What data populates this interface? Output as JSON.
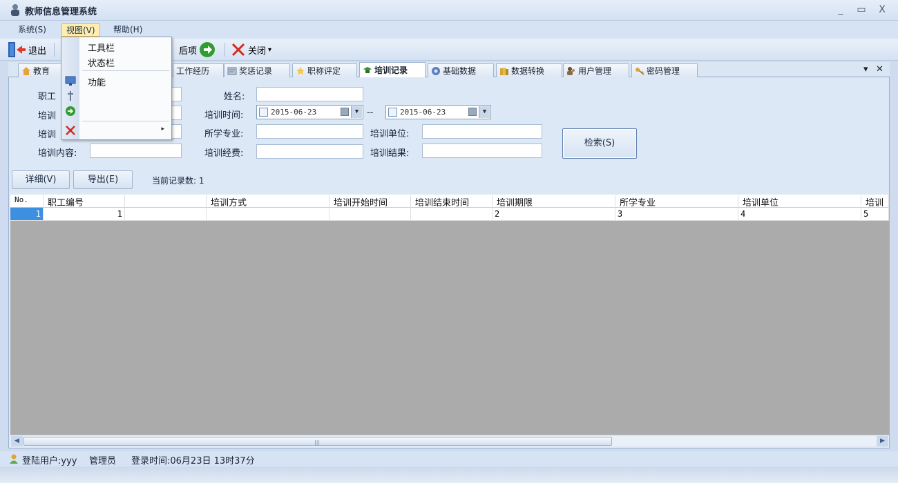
{
  "window": {
    "title": "教师信息管理系统",
    "min": "_",
    "max": "▭",
    "close": "X"
  },
  "menu": [
    {
      "label": "系统(S)"
    },
    {
      "label": "视图(V)"
    },
    {
      "label": "帮助(H)"
    }
  ],
  "toolbar": {
    "exit": "退出",
    "next": "后项",
    "close": "关闭",
    "close_arrow": "▾"
  },
  "tabs": [
    {
      "label": "教育",
      "icon": "house-icon",
      "color": "#e7a33b"
    },
    {
      "label": "工作经历",
      "icon": "",
      "color": ""
    },
    {
      "label": "奖惩记录",
      "icon": "certificate-icon",
      "color": "#8a99b4"
    },
    {
      "label": "职称评定",
      "icon": "star-icon",
      "color": "#f4c84a"
    },
    {
      "label": "培训记录",
      "icon": "grad-cap-icon",
      "color": "#3c8d3a"
    },
    {
      "label": "基础数据",
      "icon": "gear-icon",
      "color": "#5a7ec4"
    },
    {
      "label": "数据转换",
      "icon": "books-icon",
      "color": "#d6a334"
    },
    {
      "label": "用户管理",
      "icon": "users-icon",
      "color": "#6b4b2c"
    },
    {
      "label": "密码管理",
      "icon": "key-icon",
      "color": "#d9a740"
    }
  ],
  "tab_ctrl": {
    "dropdown": "▾",
    "close": "✕"
  },
  "form": {
    "staff_id": "职工",
    "train_mode": "培训",
    "train_period": "培训",
    "train_content": "培训内容:",
    "name": "姓名:",
    "train_time": "培训时间:",
    "date_from": "2015-06-23",
    "date_sep": "--",
    "date_to": "2015-06-23",
    "major": "所学专业:",
    "train_fee": "培训经费:",
    "train_unit": "培训单位:",
    "train_result": "培训结果:",
    "search": "检索(S)"
  },
  "actions": {
    "detail": "详细(V)",
    "export": "导出(E)",
    "record_count": "当前记录数: 1"
  },
  "table": {
    "columns": [
      "No.",
      "职工编号",
      "",
      "培训方式",
      "培训开始时间",
      "培训结束时间",
      "培训期限",
      "所学专业",
      "培训单位",
      "培训"
    ],
    "rows": [
      [
        "1",
        "1",
        "",
        "",
        "",
        "",
        "2",
        "3",
        "4",
        "5"
      ]
    ]
  },
  "scroll": {
    "left": "◀",
    "right": "▶",
    "grip": "|||"
  },
  "status": {
    "user": "登陆用户:yyy",
    "role": "管理员",
    "login_time": "登录时间:06月23日 13时37分"
  },
  "view_menu": [
    {
      "label": "工具栏",
      "icon": ""
    },
    {
      "label": "状态栏",
      "icon": ""
    },
    {
      "label": "功能",
      "icon": "monitor-icon"
    },
    {
      "label": "",
      "icon": "pin-icon"
    },
    {
      "label": "",
      "icon": "arrow-right-icon"
    },
    {
      "label": "",
      "icon": "close-icon",
      "submenu": "▸"
    }
  ]
}
